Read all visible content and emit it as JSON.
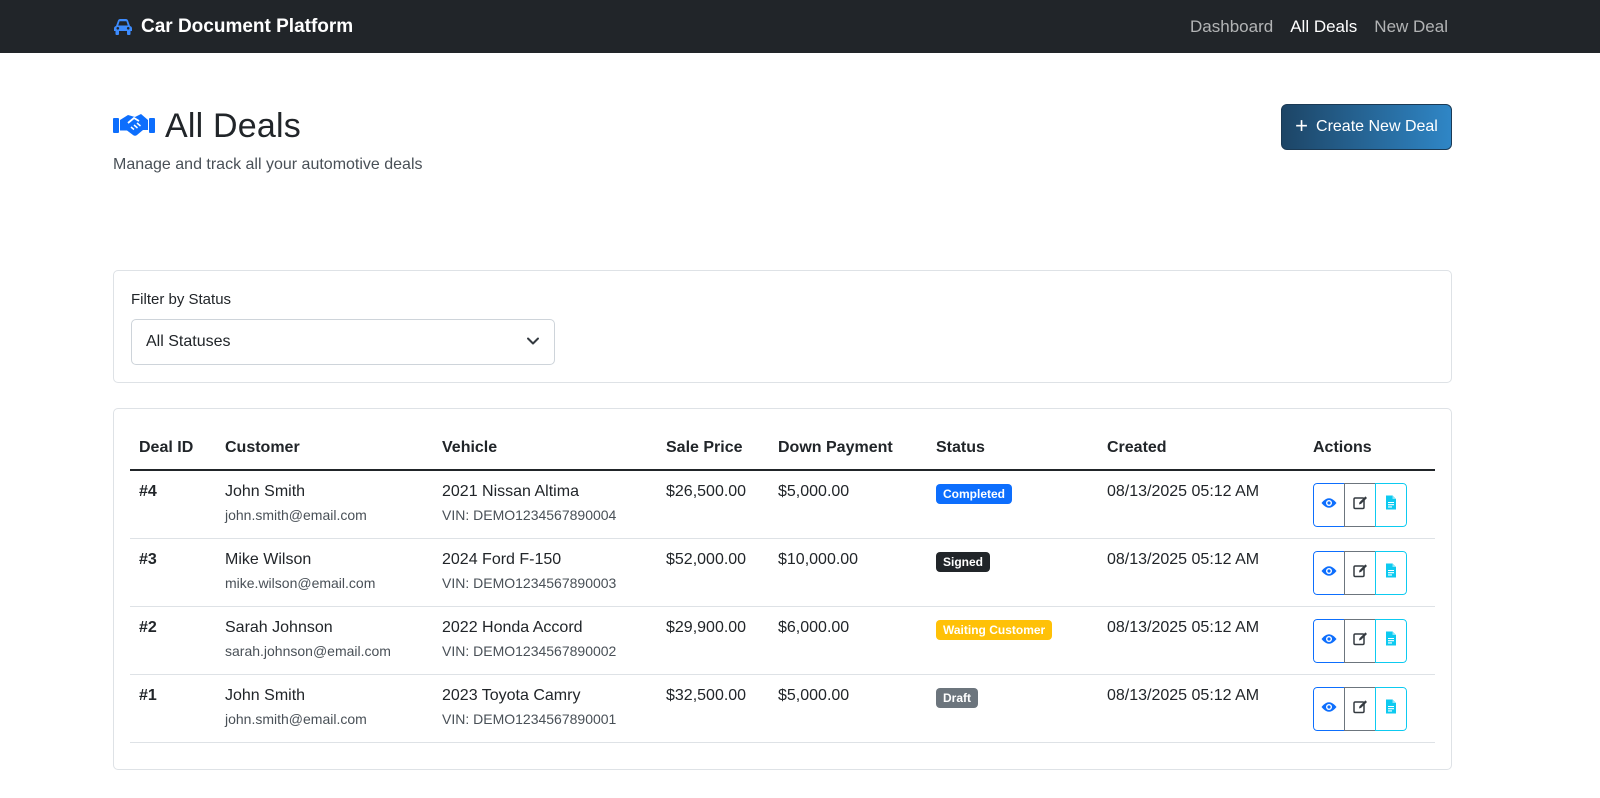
{
  "navbar": {
    "brand": "Car Document Platform",
    "links": [
      {
        "label": "Dashboard",
        "active": false
      },
      {
        "label": "All Deals",
        "active": true
      },
      {
        "label": "New Deal",
        "active": false
      }
    ]
  },
  "header": {
    "title": "All Deals",
    "subtitle": "Manage and track all your automotive deals",
    "create_button": "Create New Deal"
  },
  "filter": {
    "label": "Filter by Status",
    "selected": "All Statuses"
  },
  "table": {
    "columns": [
      "Deal ID",
      "Customer",
      "Vehicle",
      "Sale Price",
      "Down Payment",
      "Status",
      "Created",
      "Actions"
    ],
    "rows": [
      {
        "id": "#4",
        "customer": "John Smith",
        "email": "john.smith@email.com",
        "vehicle": "2021 Nissan Altima",
        "vin": "VIN: DEMO1234567890004",
        "sale_price": "$26,500.00",
        "down_payment": "$5,000.00",
        "status": "Completed",
        "status_color": "#0d6efd",
        "created": "08/13/2025 05:12 AM"
      },
      {
        "id": "#3",
        "customer": "Mike Wilson",
        "email": "mike.wilson@email.com",
        "vehicle": "2024 Ford F-150",
        "vin": "VIN: DEMO1234567890003",
        "sale_price": "$52,000.00",
        "down_payment": "$10,000.00",
        "status": "Signed",
        "status_color": "#212529",
        "created": "08/13/2025 05:12 AM"
      },
      {
        "id": "#2",
        "customer": "Sarah Johnson",
        "email": "sarah.johnson@email.com",
        "vehicle": "2022 Honda Accord",
        "vin": "VIN: DEMO1234567890002",
        "sale_price": "$29,900.00",
        "down_payment": "$6,000.00",
        "status": "Waiting Customer",
        "status_color": "#ffc107",
        "created": "08/13/2025 05:12 AM"
      },
      {
        "id": "#1",
        "customer": "John Smith",
        "email": "john.smith@email.com",
        "vehicle": "2023 Toyota Camry",
        "vin": "VIN: DEMO1234567890001",
        "sale_price": "$32,500.00",
        "down_payment": "$5,000.00",
        "status": "Draft",
        "status_color": "#6c757d",
        "created": "08/13/2025 05:12 AM"
      }
    ]
  },
  "icons": {
    "brand": "car-icon",
    "title": "handshake-icon",
    "create": "plus-icon",
    "select": "chevron-down-icon",
    "view": "eye-icon",
    "edit": "edit-icon",
    "document": "document-icon"
  },
  "colors": {
    "navbar": "#212529",
    "primary": "#0d6efd",
    "secondary": "#6c757d",
    "info": "#0dcaf0"
  }
}
